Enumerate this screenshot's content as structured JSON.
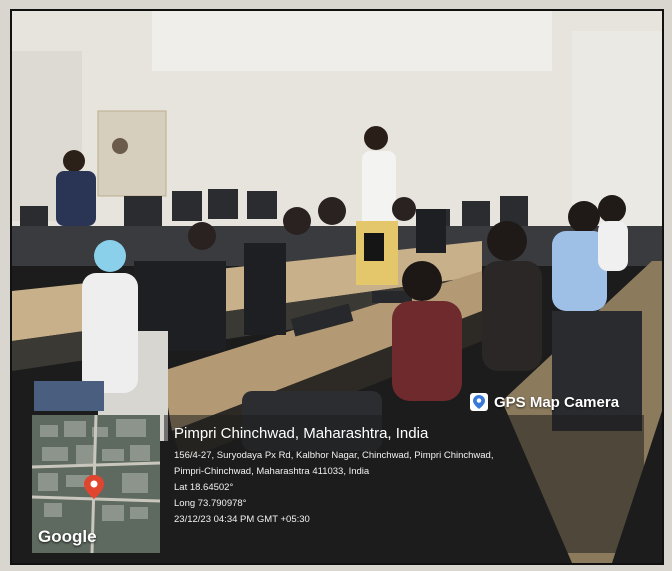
{
  "overlay": {
    "badge_label": "GPS Map Camera",
    "location_title": "Pimpri Chinchwad, Maharashtra, India",
    "address_line1": "156/4-27, Suryodaya Px Rd, Kalbhor Nagar, Chinchwad, Pimpri Chinchwad,",
    "address_line2": "Pimpri-Chinchwad, Maharashtra 411033, India",
    "latitude": "Lat 18.64502°",
    "longitude": "Long 73.790978°",
    "timestamp": "23/12/23 04:34 PM GMT +05:30",
    "map_brand": "Google"
  },
  "colors": {
    "wall": "#e8e6df",
    "bench": "#b49a74",
    "monitor": "#1e1f22",
    "overlay_bg": "#2a2a2a",
    "map_pin": "#e0452f"
  }
}
